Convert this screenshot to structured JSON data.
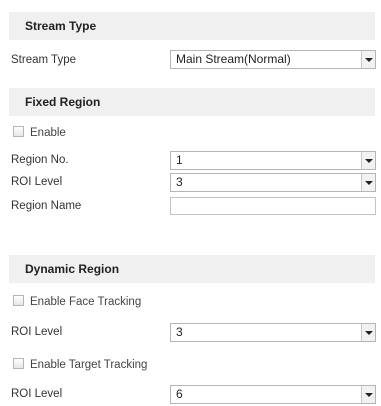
{
  "stream_type": {
    "header": "Stream Type",
    "label": "Stream Type",
    "value": "Main Stream(Normal)"
  },
  "fixed_region": {
    "header": "Fixed Region",
    "enable_label": "Enable",
    "enabled": false,
    "region_no_label": "Region No.",
    "region_no_value": "1",
    "roi_level_label": "ROI Level",
    "roi_level_value": "3",
    "region_name_label": "Region Name",
    "region_name_value": ""
  },
  "dynamic_region": {
    "header": "Dynamic Region",
    "face_tracking_label": "Enable Face Tracking",
    "face_tracking_enabled": false,
    "face_roi_level_label": "ROI Level",
    "face_roi_level_value": "3",
    "target_tracking_label": "Enable Target Tracking",
    "target_tracking_enabled": false,
    "target_roi_level_label": "ROI Level",
    "target_roi_level_value": "6"
  }
}
